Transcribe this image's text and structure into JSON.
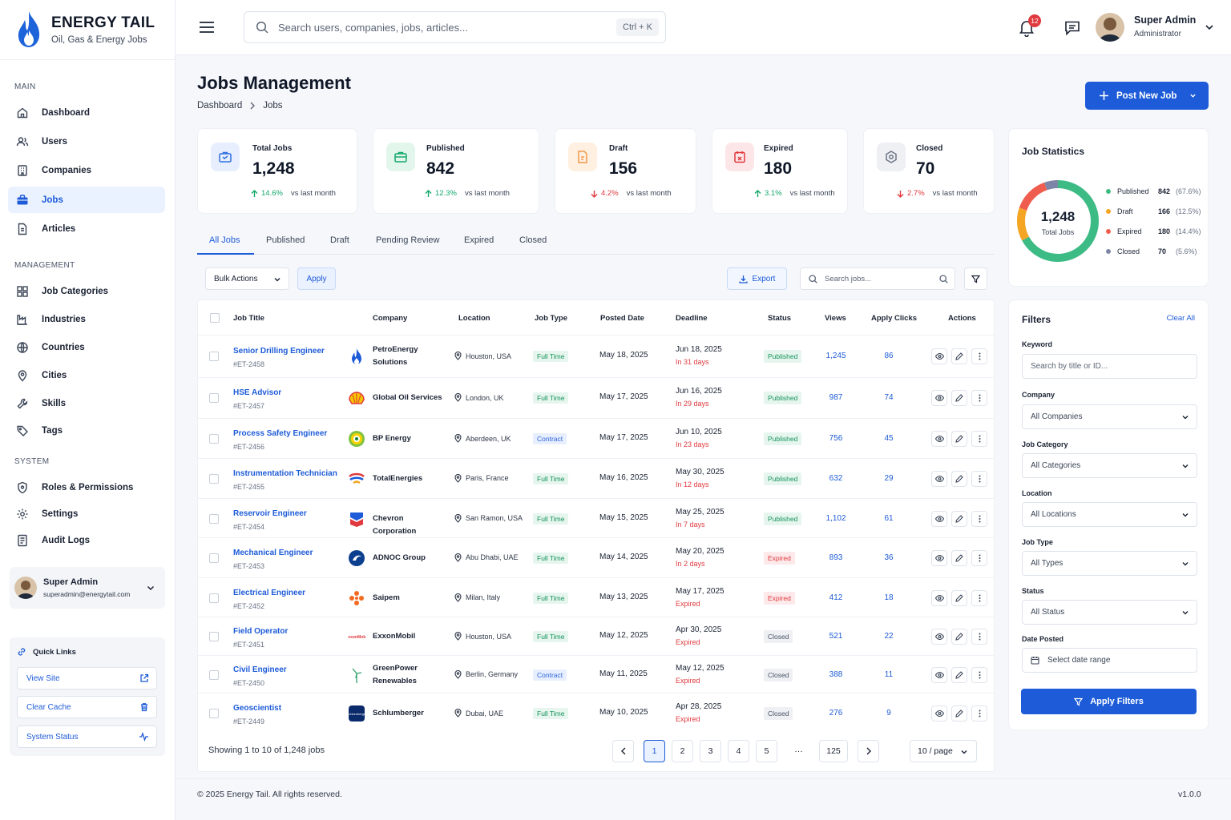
{
  "brand": {
    "title": "ENERGY TAIL",
    "subtitle": "Oil, Gas & Energy Jobs"
  },
  "sidebar": {
    "sections": {
      "main": "MAIN",
      "management": "MANAGEMENT",
      "system": "SYSTEM"
    },
    "main_items": [
      {
        "label": "Dashboard",
        "icon": "home-icon"
      },
      {
        "label": "Users",
        "icon": "users-icon"
      },
      {
        "label": "Companies",
        "icon": "building-icon"
      },
      {
        "label": "Jobs",
        "icon": "briefcase-icon"
      },
      {
        "label": "Articles",
        "icon": "document-icon"
      }
    ],
    "management_items": [
      {
        "label": "Job Categories",
        "icon": "grid-icon"
      },
      {
        "label": "Industries",
        "icon": "factory-icon"
      },
      {
        "label": "Countries",
        "icon": "globe-icon"
      },
      {
        "label": "Cities",
        "icon": "pin-icon"
      },
      {
        "label": "Skills",
        "icon": "wrench-icon"
      },
      {
        "label": "Tags",
        "icon": "tag-icon"
      }
    ],
    "system_items": [
      {
        "label": "Roles & Permissions",
        "icon": "shield-icon"
      },
      {
        "label": "Settings",
        "icon": "gear-icon"
      },
      {
        "label": "Audit Logs",
        "icon": "log-icon"
      }
    ],
    "active": "Jobs",
    "user": {
      "name": "Super Admin",
      "email": "superadmin@energytail.com"
    },
    "quick_links": {
      "title": "Quick Links",
      "items": [
        {
          "label": "View Site",
          "icon": "external-link-icon"
        },
        {
          "label": "Clear Cache",
          "icon": "trash-icon"
        },
        {
          "label": "System Status",
          "icon": "activity-icon"
        }
      ]
    }
  },
  "topbar": {
    "search_placeholder": "Search users, companies, jobs, articles...",
    "shortcut": "Ctrl + K",
    "notifications": "12",
    "user_name": "Super Admin",
    "user_role": "Administrator"
  },
  "page": {
    "title": "Jobs Management",
    "breadcrumb": [
      "Dashboard",
      "Jobs"
    ],
    "post_button": "Post New Job"
  },
  "stats": [
    {
      "label": "Total Jobs",
      "value": "1,248",
      "trend": "14.6%",
      "direction": "up",
      "note": "vs last month",
      "color": "#2f6fe0",
      "bg": "#e7efff"
    },
    {
      "label": "Published",
      "value": "842",
      "trend": "12.3%",
      "direction": "up",
      "note": "vs last month",
      "color": "#14a86b",
      "bg": "#e3f6ec"
    },
    {
      "label": "Draft",
      "value": "156",
      "trend": "4.2%",
      "direction": "down",
      "note": "vs last month",
      "color": "#f2994a",
      "bg": "#fff0e1"
    },
    {
      "label": "Expired",
      "value": "180",
      "trend": "3.1%",
      "direction": "up",
      "note": "vs last month",
      "color": "#e0393e",
      "bg": "#fde6e7"
    },
    {
      "label": "Closed",
      "value": "70",
      "trend": "2.7%",
      "direction": "down",
      "note": "vs last month",
      "color": "#6a7385",
      "bg": "#eef0f4"
    }
  ],
  "job_statistics": {
    "title": "Job Statistics",
    "total": "1,248",
    "total_label": "Total Jobs",
    "segments": [
      {
        "label": "Published",
        "value": "842",
        "pct": "(67.6%)",
        "color": "#3dbb84",
        "n": 842
      },
      {
        "label": "Draft",
        "value": "166",
        "pct": "(12.5%)",
        "color": "#f5a524",
        "n": 166
      },
      {
        "label": "Expired",
        "value": "180",
        "pct": "(14.4%)",
        "color": "#ef5d4f",
        "n": 180
      },
      {
        "label": "Closed",
        "value": "70",
        "pct": "(5.6%)",
        "color": "#7d86a6",
        "n": 70
      }
    ]
  },
  "tabs": [
    "All Jobs",
    "Published",
    "Draft",
    "Pending Review",
    "Expired",
    "Closed"
  ],
  "toolbar": {
    "bulk": "Bulk Actions",
    "apply": "Apply",
    "export": "Export",
    "search_placeholder": "Search jobs..."
  },
  "table": {
    "columns": [
      "Job Title",
      "Company",
      "Location",
      "Job Type",
      "Posted Date",
      "Deadline",
      "Status",
      "Views",
      "Apply Clicks",
      "Actions"
    ],
    "rows": [
      {
        "title": "Senior Drilling Engineer",
        "id": "#ET-2458",
        "company": "PetroEnergy Solutions",
        "location": "Houston, USA",
        "type": "Full Time",
        "posted": "May 18, 2025",
        "deadline": "Jun 18, 2025",
        "remaining": "In 31 days",
        "status": "Published",
        "views": "1,245",
        "clicks": "86",
        "logo": "flame"
      },
      {
        "title": "HSE Advisor",
        "id": "#ET-2457",
        "company": "Global Oil Services",
        "location": "London, UK",
        "type": "Full Time",
        "posted": "May 17, 2025",
        "deadline": "Jun 16, 2025",
        "remaining": "In 29 days",
        "status": "Published",
        "views": "987",
        "clicks": "74",
        "logo": "shell"
      },
      {
        "title": "Process Safety Engineer",
        "id": "#ET-2456",
        "company": "BP Energy",
        "location": "Aberdeen, UK",
        "type": "Contract",
        "posted": "May 17, 2025",
        "deadline": "Jun 10, 2025",
        "remaining": "In 23 days",
        "status": "Published",
        "views": "756",
        "clicks": "45",
        "logo": "bp"
      },
      {
        "title": "Instrumentation Technician",
        "id": "#ET-2455",
        "company": "TotalEnergies",
        "location": "Paris, France",
        "type": "Full Time",
        "posted": "May 16, 2025",
        "deadline": "May 30, 2025",
        "remaining": "In 12 days",
        "status": "Published",
        "views": "632",
        "clicks": "29",
        "logo": "total"
      },
      {
        "title": "Reservoir Engineer",
        "id": "#ET-2454",
        "company": "Chevron Corporation",
        "location": "San Ramon, USA",
        "type": "Full Time",
        "posted": "May 15, 2025",
        "deadline": "May 25, 2025",
        "remaining": "In 7 days",
        "status": "Published",
        "views": "1,102",
        "clicks": "61",
        "logo": "chevron"
      },
      {
        "title": "Mechanical Engineer",
        "id": "#ET-2453",
        "company": "ADNOC Group",
        "location": "Abu Dhabi, UAE",
        "type": "Full Time",
        "posted": "May 14, 2025",
        "deadline": "May 20, 2025",
        "remaining": "In 2 days",
        "status": "Expired",
        "views": "893",
        "clicks": "36",
        "logo": "adnoc"
      },
      {
        "title": "Electrical Engineer",
        "id": "#ET-2452",
        "company": "Saipem",
        "location": "Milan, Italy",
        "type": "Full Time",
        "posted": "May 13, 2025",
        "deadline": "May 17, 2025",
        "remaining": "Expired",
        "status": "Expired",
        "views": "412",
        "clicks": "18",
        "logo": "saipem"
      },
      {
        "title": "Field Operator",
        "id": "#ET-2451",
        "company": "ExxonMobil",
        "location": "Houston, USA",
        "type": "Full Time",
        "posted": "May 12, 2025",
        "deadline": "Apr 30, 2025",
        "remaining": "Expired",
        "status": "Closed",
        "views": "521",
        "clicks": "22",
        "logo": "exxon"
      },
      {
        "title": "Civil Engineer",
        "id": "#ET-2450",
        "company": "GreenPower Renewables",
        "location": "Berlin, Germany",
        "type": "Contract",
        "posted": "May 11, 2025",
        "deadline": "May 12, 2025",
        "remaining": "Expired",
        "status": "Closed",
        "views": "388",
        "clicks": "11",
        "logo": "wind"
      },
      {
        "title": "Geoscientist",
        "id": "#ET-2449",
        "company": "Schlumberger",
        "location": "Dubai, UAE",
        "type": "Full Time",
        "posted": "May 10, 2025",
        "deadline": "Apr 28, 2025",
        "remaining": "Expired",
        "status": "Closed",
        "views": "276",
        "clicks": "9",
        "logo": "slb"
      }
    ]
  },
  "pagination": {
    "summary": "Showing 1 to 10 of 1,248 jobs",
    "pages": [
      "1",
      "2",
      "3",
      "4",
      "5",
      "···",
      "125"
    ],
    "per_page": "10 / page"
  },
  "filters": {
    "title": "Filters",
    "clear": "Clear All",
    "keyword_label": "Keyword",
    "keyword_placeholder": "Search by title or ID...",
    "company_label": "Company",
    "company_value": "All Companies",
    "category_label": "Job Category",
    "category_value": "All Categories",
    "location_label": "Location",
    "location_value": "All Locations",
    "type_label": "Job Type",
    "type_value": "All Types",
    "status_label": "Status",
    "status_value": "All Status",
    "date_label": "Date Posted",
    "date_placeholder": "Select date range",
    "apply": "Apply Filters"
  },
  "footer": {
    "copyright": "© 2025 Energy Tail. All rights reserved.",
    "version": "v1.0.0"
  }
}
